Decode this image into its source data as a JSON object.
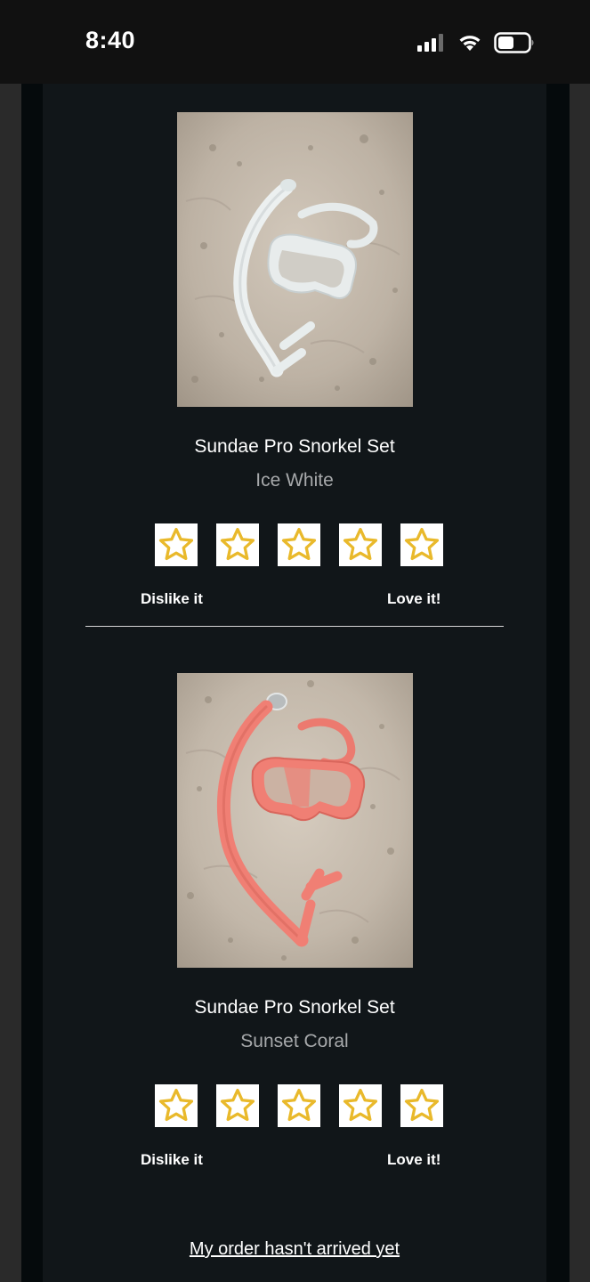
{
  "status_bar": {
    "time": "8:40",
    "icons": [
      "cellular-signal-icon",
      "wifi-icon",
      "battery-icon"
    ]
  },
  "products": [
    {
      "name": "Sundae Pro Snorkel Set",
      "variant": "Ice White",
      "image_icon": "white-snorkel-set-photo",
      "product_color": "#e9ecec"
    },
    {
      "name": "Sundae Pro Snorkel Set",
      "variant": "Sunset Coral",
      "image_icon": "coral-snorkel-set-photo",
      "product_color": "#f07f74"
    }
  ],
  "rating": {
    "dislike_label": "Dislike it",
    "love_label": "Love it!",
    "star_count": 5,
    "star_color": "#e9b92b"
  },
  "footer": {
    "order_link": "My order hasn't arrived yet"
  },
  "colors": {
    "background": "#111619",
    "frame": "#050a0c",
    "text": "#ffffff",
    "muted_text": "#a7a9ab"
  }
}
